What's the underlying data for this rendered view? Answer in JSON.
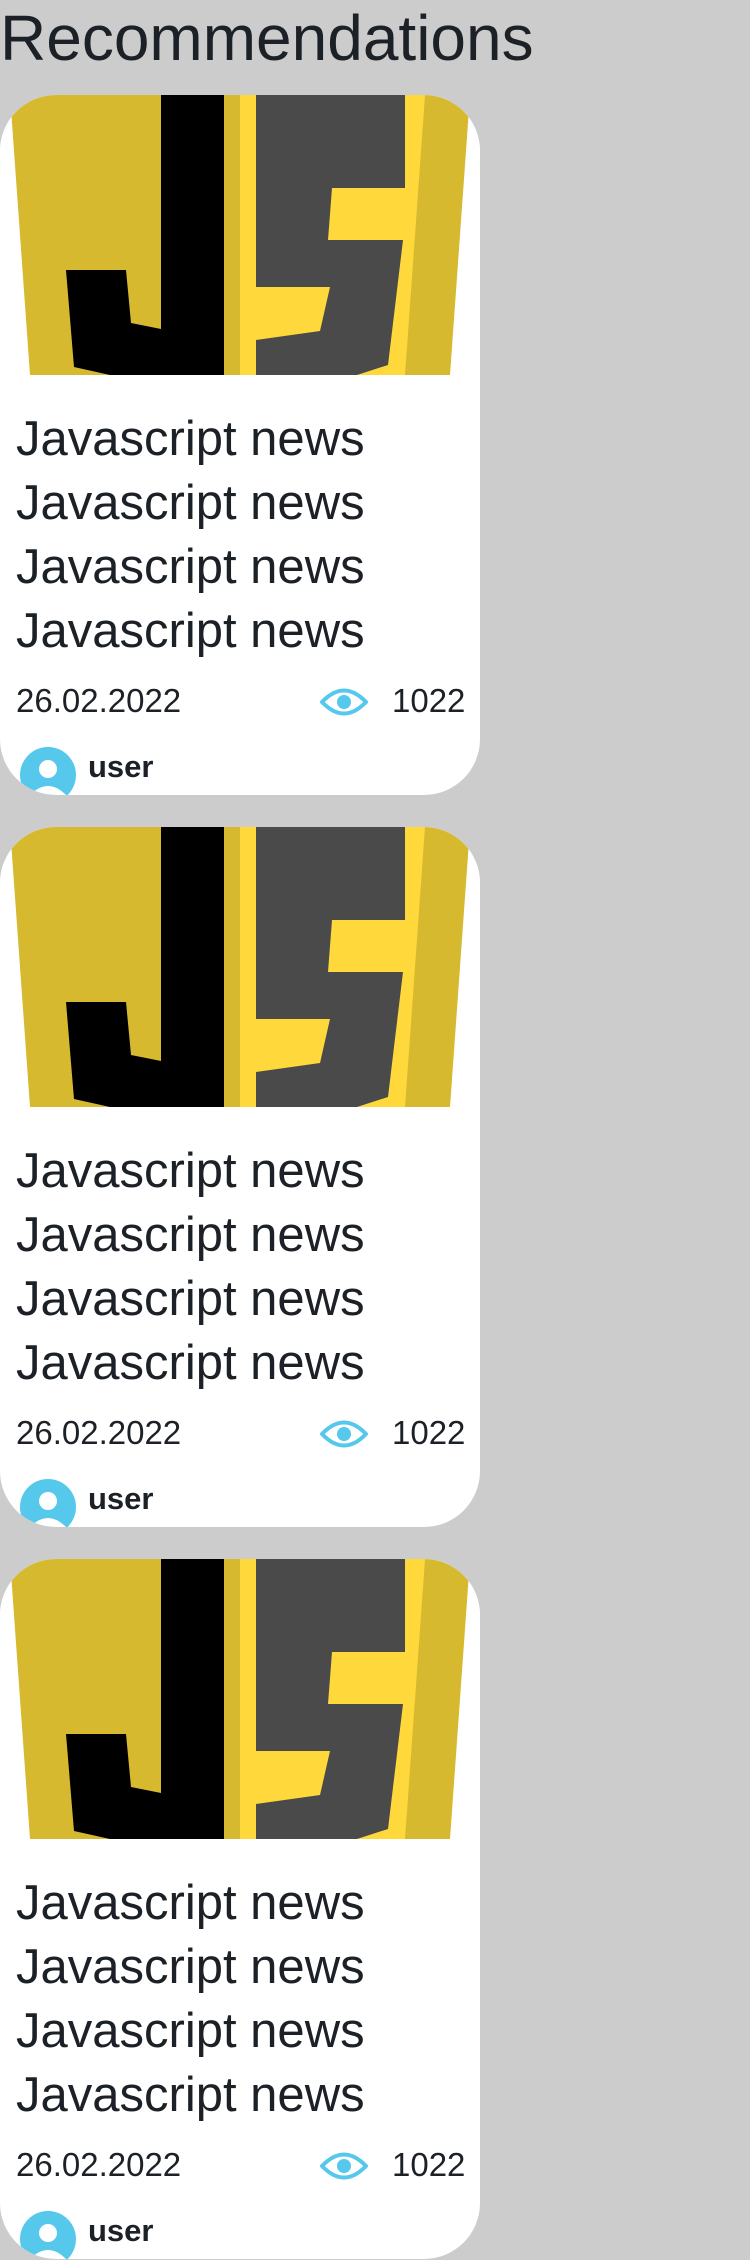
{
  "page": {
    "title": "Recommendations"
  },
  "colors": {
    "background": "#cccccc",
    "card": "#ffffff",
    "text": "#1c2127",
    "accent": "#56c8ec",
    "js_yellow_dark": "#d6b92f",
    "js_yellow_light": "#ffd83b",
    "js_black": "#000000",
    "js_grey": "#4a4a4a"
  },
  "cards": [
    {
      "image_icon": "javascript-logo",
      "headline_lines": [
        "Javascript news",
        "Javascript news",
        "Javascript news",
        "Javascript news"
      ],
      "date": "26.02.2022",
      "views_icon": "eye-icon",
      "views": "1022",
      "avatar_icon": "user-avatar-icon",
      "author": "user"
    },
    {
      "image_icon": "javascript-logo",
      "headline_lines": [
        "Javascript news",
        "Javascript news",
        "Javascript news",
        "Javascript news"
      ],
      "date": "26.02.2022",
      "views_icon": "eye-icon",
      "views": "1022",
      "avatar_icon": "user-avatar-icon",
      "author": "user"
    },
    {
      "image_icon": "javascript-logo",
      "headline_lines": [
        "Javascript news",
        "Javascript news",
        "Javascript news",
        "Javascript news"
      ],
      "date": "26.02.2022",
      "views_icon": "eye-icon",
      "views": "1022",
      "avatar_icon": "user-avatar-icon",
      "author": "user"
    }
  ]
}
